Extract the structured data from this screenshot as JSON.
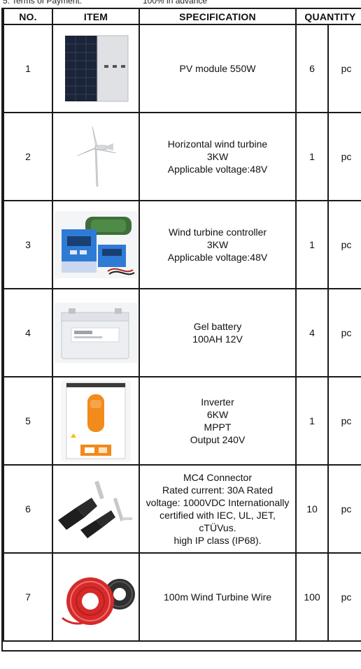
{
  "header_note": {
    "left": "5. Terms of Payment:",
    "right": "100% in advance"
  },
  "table": {
    "headers": {
      "no": "NO.",
      "item": "ITEM",
      "specification": "SPECIFICATION",
      "quantity": "QUANTITY"
    },
    "rows": [
      {
        "no": "1",
        "image": "solar-panel-image",
        "spec": [
          "PV module 550W"
        ],
        "qty": "6",
        "unit": "pc"
      },
      {
        "no": "2",
        "image": "wind-turbine-image",
        "spec": [
          "Horizontal wind turbine",
          "3KW",
          "Applicable voltage:48V"
        ],
        "qty": "1",
        "unit": "pc"
      },
      {
        "no": "3",
        "image": "wind-controller-image",
        "spec": [
          "Wind turbine controller",
          "3KW",
          "Applicable voltage:48V"
        ],
        "qty": "1",
        "unit": "pc"
      },
      {
        "no": "4",
        "image": "gel-battery-image",
        "spec": [
          "Gel battery",
          "100AH 12V"
        ],
        "qty": "4",
        "unit": "pc"
      },
      {
        "no": "5",
        "image": "inverter-image",
        "spec": [
          "Inverter",
          "6KW",
          "MPPT",
          "Output 240V"
        ],
        "qty": "1",
        "unit": "pc"
      },
      {
        "no": "6",
        "image": "mc4-connector-image",
        "spec": [
          "MC4 Connector",
          "Rated current: 30A Rated",
          "voltage: 1000VDC Internationally",
          "certified with IEC, UL, JET,",
          "cTÜVus.",
          "high IP class (IP68)."
        ],
        "qty": "10",
        "unit": "pc"
      },
      {
        "no": "7",
        "image": "cable-reel-image",
        "spec": [
          "100m Wind Turbine Wire"
        ],
        "qty": "100",
        "unit": "pc"
      }
    ]
  }
}
